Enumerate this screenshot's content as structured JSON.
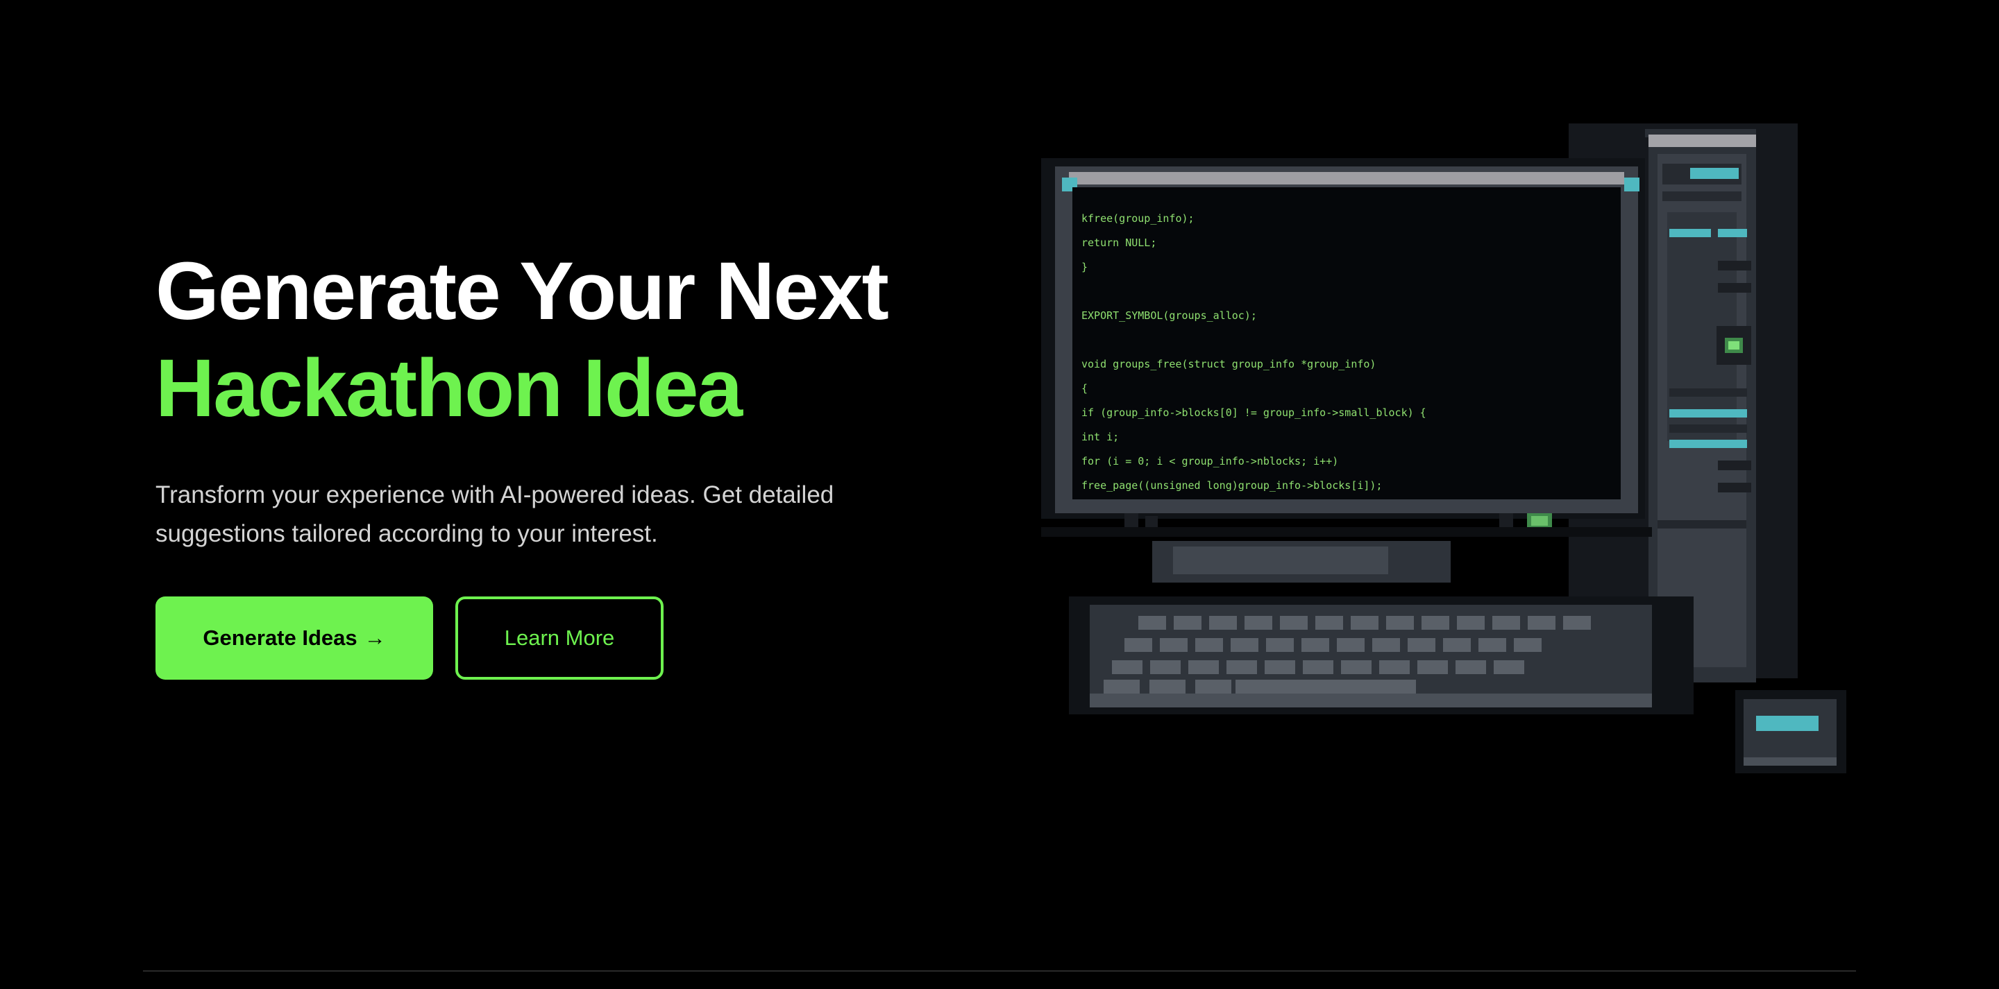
{
  "hero": {
    "title_line_1": "Generate Your Next",
    "title_line_2": "Hackathon Idea",
    "subtitle": "Transform your experience with AI-powered ideas. Get detailed suggestions tailored according to your interest.",
    "primary_button_label": "Generate Ideas",
    "primary_button_arrow": "→",
    "secondary_button_label": "Learn More"
  },
  "illustration": {
    "code_lines": [
      "    kfree(group_info);",
      "    return NULL;",
      "}",
      "",
      "EXPORT_SYMBOL(groups_alloc);",
      "",
      "void groups_free(struct group_info *group_info)",
      "{",
      "    if (group_info->blocks[0] != group_info->small_block) {",
      "        int i;",
      "        for (i = 0; i < group_info->nblocks; i++)",
      "            free_page((unsigned long)group_info->blocks[i]);",
      "    }",
      "    kfree(group_info);"
    ]
  },
  "colors": {
    "background": "#000000",
    "accent": "#6ef24f",
    "subtitle": "#d4d4d4",
    "code": "#8fe070",
    "teal": "#4fb8c0"
  }
}
